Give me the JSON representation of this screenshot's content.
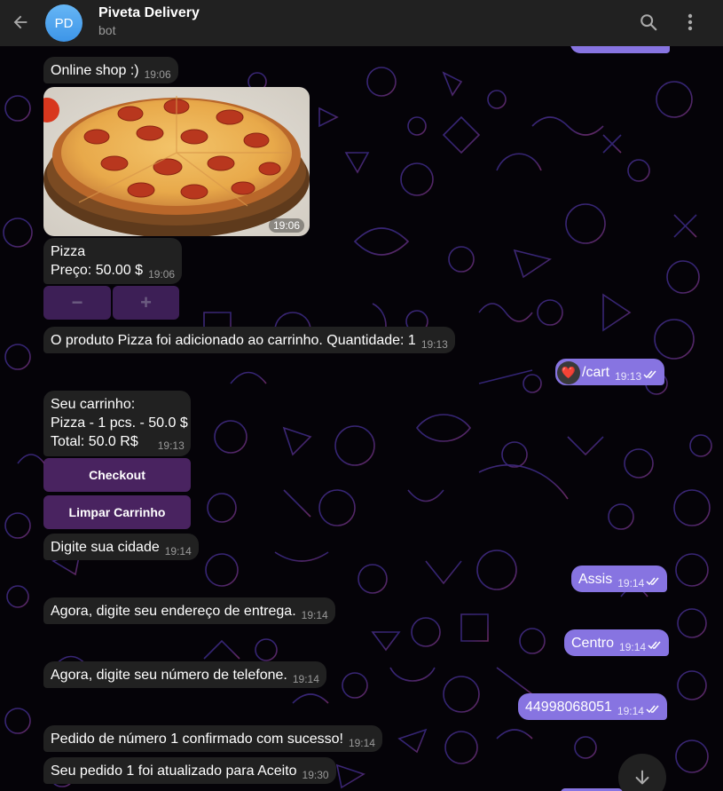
{
  "header": {
    "avatar_initials": "PD",
    "title": "Piveta Delivery",
    "subtitle": "bot",
    "back_icon": "arrow-left-icon",
    "search_icon": "search-icon",
    "menu_icon": "more-vertical-icon"
  },
  "colors": {
    "incoming_bubble": "#212121",
    "outgoing_bubble": "#8774e1",
    "keyboard_button": "#5c2d7a",
    "avatar": "#4aa3f0"
  },
  "messages": {
    "m1": {
      "text": "Online shop :)",
      "time": "19:06"
    },
    "photo": {
      "time": "19:06",
      "alt": "pizza"
    },
    "product_name": "Pizza",
    "product_price": "Preço: 50.00 $",
    "product_time": "19:06",
    "minus_label": "−",
    "plus_label": "+",
    "m_added": {
      "text": "O produto Pizza foi adicionado ao carrinho. Quantidade: 1",
      "time": "19:13"
    },
    "m_cart_cmd": {
      "text": "/cart",
      "time": "19:13",
      "reaction": "❤️"
    },
    "cart_line1": "Seu carrinho:",
    "cart_line2": "Pizza - 1 pcs. - 50.0 $",
    "cart_line3": "Total: 50.0 R$",
    "cart_time": "19:13",
    "checkout_label": "Checkout",
    "clear_cart_label": "Limpar Carrinho",
    "m_city_prompt": {
      "text": "Digite sua cidade",
      "time": "19:14"
    },
    "m_city": {
      "text": "Assis",
      "time": "19:14"
    },
    "m_address_prompt": {
      "text": "Agora, digite seu endereço de entrega.",
      "time": "19:14"
    },
    "m_address": {
      "text": "Centro",
      "time": "19:14"
    },
    "m_phone_prompt": {
      "text": "Agora, digite seu número de telefone.",
      "time": "19:14"
    },
    "m_phone": {
      "text": "44998068051",
      "time": "19:14"
    },
    "m_confirmed": {
      "text": "Pedido de número 1 confirmado com sucesso!",
      "time": "19:14"
    },
    "m_status": {
      "text": "Seu pedido 1 foi atualizado para Aceito",
      "time": "19:30"
    }
  },
  "scroll_down_icon": "arrow-down-icon"
}
